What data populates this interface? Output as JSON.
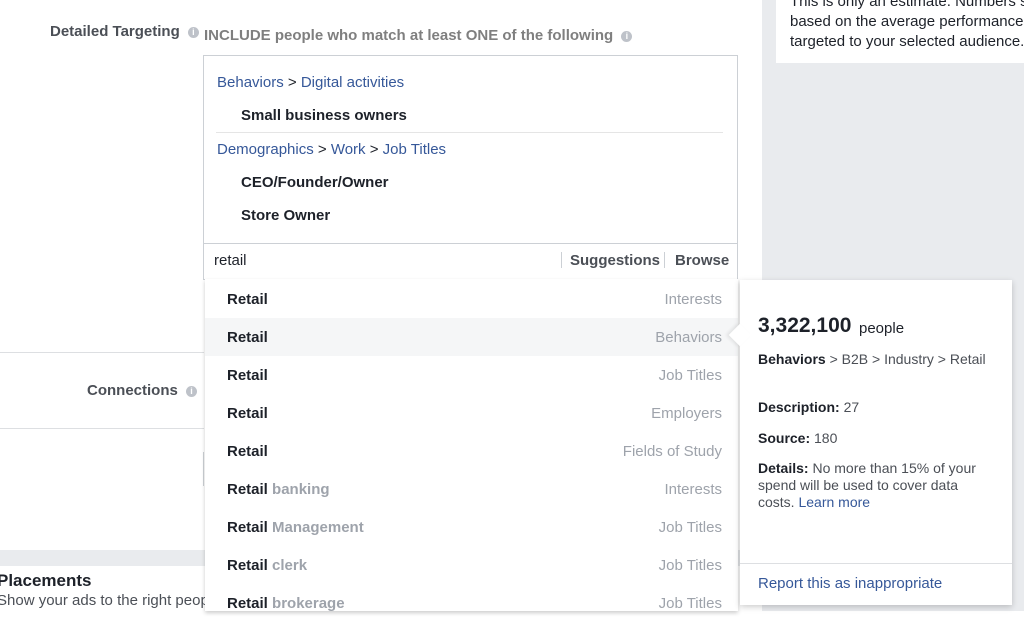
{
  "estimate": {
    "lines": [
      "This is only an estimate. Numbers sh",
      "based on the average performance o",
      "targeted to your selected audience."
    ]
  },
  "detailed_targeting": {
    "label": "Detailed Targeting",
    "include_text": "INCLUDE people who match at least ONE of the following",
    "groups": [
      {
        "path": [
          "Behaviors",
          "Digital activities"
        ],
        "items": [
          "Small business owners"
        ]
      },
      {
        "path": [
          "Demographics",
          "Work",
          "Job Titles"
        ],
        "items": [
          "CEO/Founder/Owner",
          "Store Owner"
        ]
      }
    ],
    "path_separator": ">"
  },
  "search": {
    "value": "retail",
    "suggestions_label": "Suggestions",
    "browse_label": "Browse"
  },
  "dropdown": {
    "rows": [
      {
        "bold": "Retail",
        "rest": "",
        "category": "Interests"
      },
      {
        "bold": "Retail",
        "rest": "",
        "category": "Behaviors",
        "highlighted": true
      },
      {
        "bold": "Retail",
        "rest": "",
        "category": "Job Titles"
      },
      {
        "bold": "Retail",
        "rest": "",
        "category": "Employers"
      },
      {
        "bold": "Retail",
        "rest": "",
        "category": "Fields of Study"
      },
      {
        "bold": "Retail",
        "rest": " banking",
        "category": "Interests"
      },
      {
        "bold": "Retail",
        "rest": " Management",
        "category": "Job Titles"
      },
      {
        "bold": "Retail",
        "rest": " clerk",
        "category": "Job Titles"
      },
      {
        "bold": "Retail",
        "rest": " brokerage",
        "category": "Job Titles"
      }
    ]
  },
  "connections": {
    "label": "Connections"
  },
  "popup": {
    "count": "3,322,100",
    "count_unit": "people",
    "path_lead": "Behaviors",
    "path_rest": " > B2B > Industry > Retail",
    "description_label": "Description:",
    "description_value": " 27",
    "source_label": "Source:",
    "source_value": " 180",
    "details_label": "Details:",
    "details_value": " No more than 15% of your spend will be used to cover data costs. ",
    "learn_more": "Learn more",
    "report": "Report this as inappropriate"
  },
  "placements": {
    "title": "Placements",
    "subtitle": "Show your ads to the right people"
  },
  "colors": {
    "link": "#365899",
    "panel_bg": "#e9ebee",
    "muted": "#9ea3ab"
  }
}
